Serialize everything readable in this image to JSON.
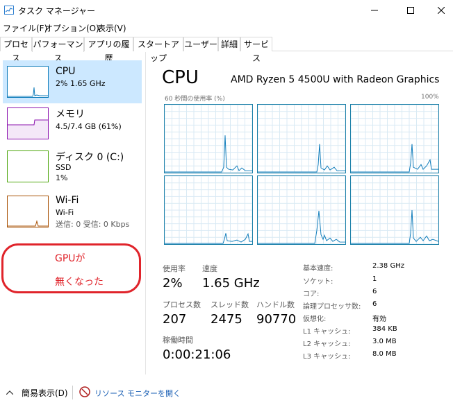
{
  "window": {
    "title": "タスク マネージャー",
    "icons": {
      "app": "task-manager-icon",
      "minimize": "minimize-icon",
      "maximize": "maximize-icon",
      "close": "close-icon"
    }
  },
  "menu": [
    "ファイル(F)",
    "オプション(O)",
    "表示(V)"
  ],
  "tabs": [
    "プロセス",
    "パフォーマンス",
    "アプリの履歴",
    "スタートアップ",
    "ユーザー",
    "詳細",
    "サービス"
  ],
  "active_tab": "パフォーマンス",
  "sidebar": {
    "items": [
      {
        "title": "CPU",
        "line1": "2%  1.65 GHz",
        "line2": "",
        "line3": "",
        "color": "#117dbb",
        "active": true
      },
      {
        "title": "メモリ",
        "line1": "4.5/7.4 GB (61%)",
        "line2": "",
        "line3": "",
        "color": "#8b12ae",
        "active": false
      },
      {
        "title": "ディスク 0 (C:)",
        "line1": "SSD",
        "line2": "1%",
        "line3": "",
        "color": "#4da60c",
        "active": false
      },
      {
        "title": "Wi-Fi",
        "line1": "Wi-Fi",
        "line2": "送信: 0 受信: 0 Kbps",
        "line3": "",
        "color": "#a74f01",
        "active": false
      }
    ]
  },
  "annotation": {
    "line1": "GPUが",
    "line2": "無くなった",
    "color": "#e0242b"
  },
  "main": {
    "title": "CPU",
    "model": "AMD Ryzen 5 4500U with Radeon Graphics",
    "chart_caption_left": "60 秒間の使用率 (%)",
    "chart_caption_right": "100%",
    "graph_color": "#117dbb"
  },
  "stats": {
    "usage_label": "使用率",
    "usage_value": "2%",
    "speed_label": "速度",
    "speed_value": "1.65 GHz",
    "processes_label": "プロセス数",
    "processes_value": "207",
    "threads_label": "スレッド数",
    "threads_value": "2475",
    "handles_label": "ハンドル数",
    "handles_value": "90770",
    "uptime_label": "稼働時間",
    "uptime_value": "0:00:21:06"
  },
  "specs": [
    {
      "label": "基本速度:",
      "value": "2.38 GHz"
    },
    {
      "label": "ソケット:",
      "value": "1"
    },
    {
      "label": "コア:",
      "value": "6"
    },
    {
      "label": "論理プロセッサ数:",
      "value": "6"
    },
    {
      "label": "仮想化:",
      "value": "有効"
    },
    {
      "label": "L1 キャッシュ:",
      "value": "384 KB"
    },
    {
      "label": "L2 キャッシュ:",
      "value": "3.0 MB"
    },
    {
      "label": "L3 キャッシュ:",
      "value": "8.0 MB"
    }
  ],
  "bottom": {
    "fewer_details": "簡易表示(D)",
    "resource_monitor": "リソース モニターを開く",
    "icons": {
      "collapse": "chevron-up-icon",
      "monitor": "resource-monitor-icon"
    }
  }
}
